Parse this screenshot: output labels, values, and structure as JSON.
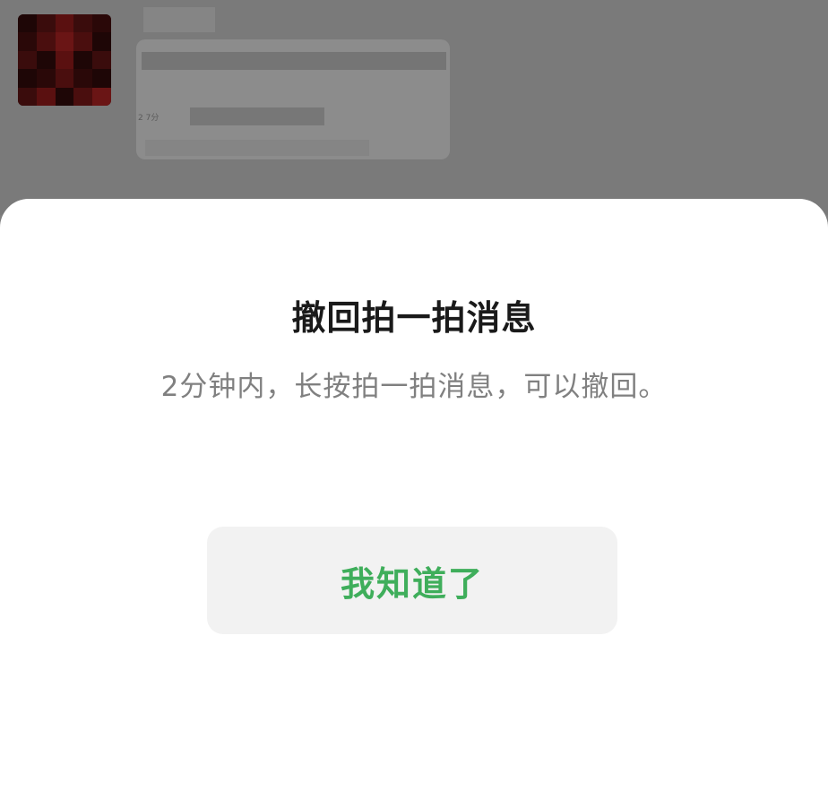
{
  "background": {
    "timestamp_label": "2 7分"
  },
  "dialog": {
    "title": "撤回拍一拍消息",
    "description": "2分钟内，长按拍一拍消息，可以撤回。",
    "confirm_button_label": "我知道了"
  },
  "colors": {
    "accent_green": "#3fae5b",
    "button_bg": "#f2f2f2",
    "overlay": "#7f7f7f"
  }
}
